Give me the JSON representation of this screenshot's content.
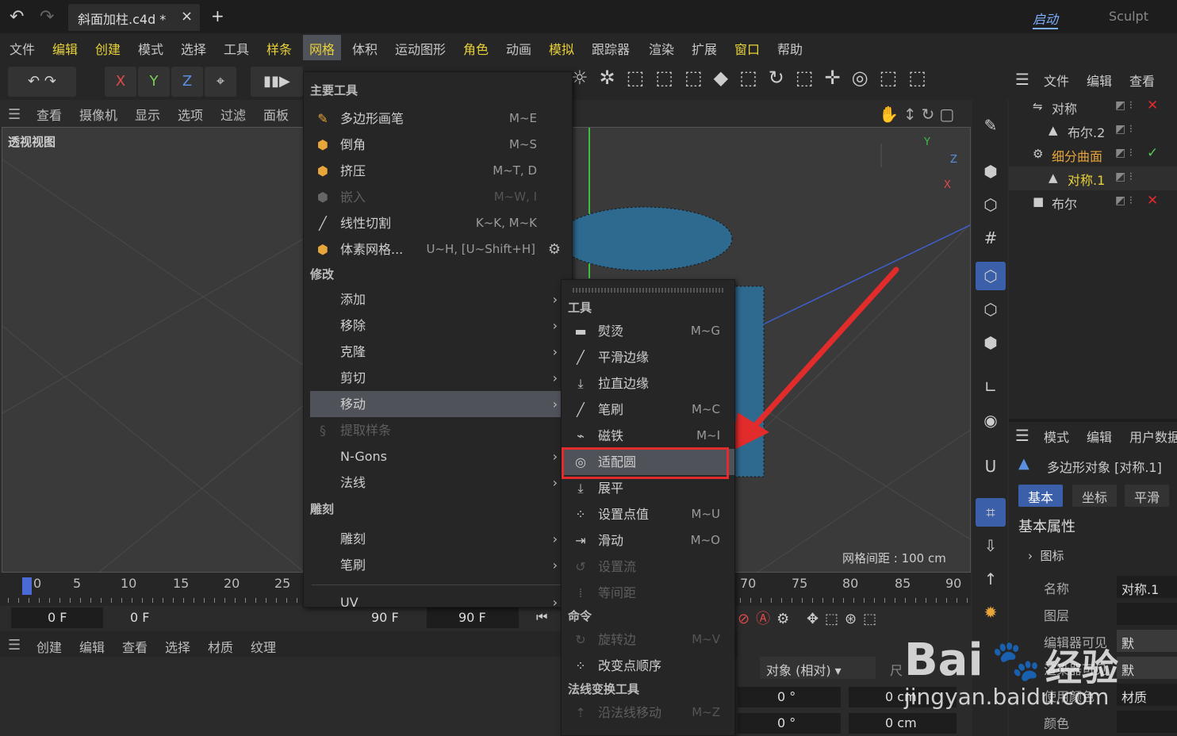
{
  "titlebar": {
    "undo_icon": "undo-icon",
    "redo_icon": "redo-icon",
    "tab_title": "斜面加柱.c4d *",
    "close": "×",
    "add": "+",
    "layout_start": "启动",
    "layout_sculpt": "Sculpt"
  },
  "menubar": [
    "文件",
    "编辑",
    "创建",
    "模式",
    "选择",
    "工具",
    "样条",
    "网格",
    "体积",
    "运动图形",
    "角色",
    "动画",
    "模拟",
    "跟踪器",
    "渲染",
    "扩展",
    "窗口",
    "帮助"
  ],
  "toolbar": {
    "x": "X",
    "y": "Y",
    "z": "Z"
  },
  "viewport": {
    "menu": [
      "查看",
      "摄像机",
      "显示",
      "选项",
      "过滤",
      "面板"
    ],
    "label": "透视视图",
    "grid_spacing": "网格间距 : 100 cm",
    "axis_y": "Y",
    "axis_z": "Z",
    "axis_x": "X"
  },
  "timeline": {
    "ticks_left": [
      "0",
      "5",
      "10",
      "15",
      "20",
      "25"
    ],
    "ticks_right": [
      "70",
      "75",
      "80",
      "85",
      "90"
    ],
    "frame_current": "0 F",
    "frame_start": "0 F",
    "frame_end": "90 F",
    "frame_max": "90 F"
  },
  "material_bar": [
    "创建",
    "编辑",
    "查看",
    "选择",
    "材质",
    "纹理"
  ],
  "coords": {
    "mode": "对象 (相对)",
    "size_label": "尺",
    "rot1": "0 °",
    "rot2": "0 °",
    "pos1": "0 cm",
    "pos2": "0 cm"
  },
  "object_manager": {
    "menu": [
      "文件",
      "编辑",
      "查看"
    ],
    "rows": [
      {
        "name": "对称",
        "color": "#c8c8c8"
      },
      {
        "name": "布尔.2",
        "color": "#c8c8c8"
      },
      {
        "name": "细分曲面",
        "color": "#e8a53a"
      },
      {
        "name": "对称.1",
        "color": "#e8d23a"
      },
      {
        "name": "布尔",
        "color": "#c8c8c8"
      }
    ]
  },
  "attributes": {
    "menu": [
      "模式",
      "编辑",
      "用户数据"
    ],
    "object_title": "多边形对象 [对称.1]",
    "tabs": [
      "基本",
      "坐标",
      "平滑"
    ],
    "section": "基本属性",
    "group": "图标",
    "fields": [
      {
        "label": "名称",
        "value": "对称.1"
      },
      {
        "label": "图层",
        "value": ""
      },
      {
        "label": "编辑器可见",
        "value": "默"
      },
      {
        "label": "渲染器可见",
        "value": "默"
      },
      {
        "label": "使用颜色",
        "value": "材质"
      },
      {
        "label": "颜色",
        "value": ""
      }
    ]
  },
  "mesh_menu": {
    "section_main": "主要工具",
    "main_items": [
      {
        "label": "多边形画笔",
        "shortcut": "M~E",
        "enabled": true
      },
      {
        "label": "倒角",
        "shortcut": "M~S",
        "enabled": true
      },
      {
        "label": "挤压",
        "shortcut": "M~T, D",
        "enabled": true
      },
      {
        "label": "嵌入",
        "shortcut": "M~W, I",
        "enabled": false
      },
      {
        "label": "线性切割",
        "shortcut": "K~K, M~K",
        "enabled": true
      },
      {
        "label": "体素网格...",
        "shortcut": "U~H, [U~Shift+H]",
        "enabled": true
      }
    ],
    "section_modify": "修改",
    "modify_items": [
      {
        "label": "添加",
        "sub": true
      },
      {
        "label": "移除",
        "sub": true
      },
      {
        "label": "克隆",
        "sub": true
      },
      {
        "label": "剪切",
        "sub": true
      },
      {
        "label": "移动",
        "sub": true,
        "highlight": true
      },
      {
        "label": "提取样条",
        "sub": false,
        "enabled": false
      },
      {
        "label": "N-Gons",
        "sub": true
      },
      {
        "label": "法线",
        "sub": true
      }
    ],
    "section_sculpt": "雕刻",
    "sculpt_items": [
      {
        "label": "雕刻"
      },
      {
        "label": "笔刷"
      }
    ],
    "uv": "UV"
  },
  "move_submenu": {
    "section_tools": "工具",
    "tools": [
      {
        "label": "熨烫",
        "shortcut": "M~G",
        "enabled": true
      },
      {
        "label": "平滑边缘",
        "shortcut": "",
        "enabled": true
      },
      {
        "label": "拉直边缘",
        "shortcut": "",
        "enabled": true
      },
      {
        "label": "笔刷",
        "shortcut": "M~C",
        "enabled": true
      },
      {
        "label": "磁铁",
        "shortcut": "M~I",
        "enabled": true
      },
      {
        "label": "适配圆",
        "shortcut": "",
        "enabled": true,
        "highlight": true
      },
      {
        "label": "展平",
        "shortcut": "",
        "enabled": true
      },
      {
        "label": "设置点值",
        "shortcut": "M~U",
        "enabled": true
      },
      {
        "label": "滑动",
        "shortcut": "M~O",
        "enabled": true
      },
      {
        "label": "设置流",
        "shortcut": "",
        "enabled": false
      },
      {
        "label": "等间距",
        "shortcut": "",
        "enabled": false
      }
    ],
    "section_cmd": "命令",
    "commands": [
      {
        "label": "旋转边",
        "shortcut": "M~V",
        "enabled": false
      },
      {
        "label": "改变点顺序",
        "shortcut": "",
        "enabled": true
      }
    ],
    "section_normal": "法线变换工具",
    "normal_items": [
      {
        "label": "沿法线移动",
        "shortcut": "M~Z",
        "enabled": false
      }
    ]
  },
  "watermark": {
    "brand": "Bai",
    "brand2": "经验",
    "url": "jingyan.baidu.com"
  },
  "colors": {
    "accent": "#e8d23a",
    "highlight": "#4f5258",
    "red": "#e22b2b",
    "selected_blue": "#3b5fa8"
  }
}
